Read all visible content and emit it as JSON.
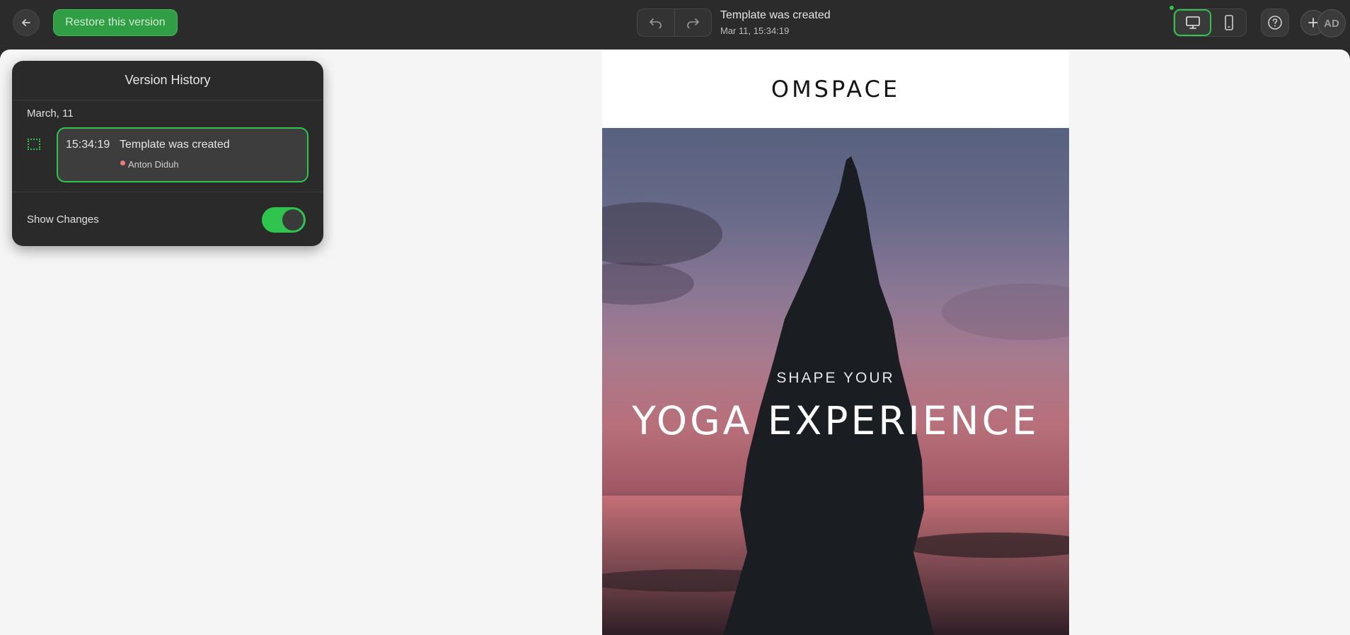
{
  "topbar": {
    "restore_label": "Restore this version",
    "status_title": "Template was created",
    "status_time": "Mar 11, 15:34:19",
    "avatar_initials": "AD"
  },
  "version_history": {
    "title": "Version History",
    "date": "March, 11",
    "entries": [
      {
        "time": "15:34:19",
        "message": "Template was created",
        "user": "Anton Diduh"
      }
    ],
    "show_changes_label": "Show Changes",
    "show_changes_on": true
  },
  "email": {
    "brand": "OMSPACE",
    "hero_kicker": "SHAPE YOUR",
    "hero_headline": "YOGA EXPERIENCE"
  },
  "colors": {
    "accent": "#2ec44e",
    "topbar_bg": "#2b2b2b",
    "canvas_bg": "#f5f5f5"
  },
  "icons": [
    "arrow-left-icon",
    "undo-icon",
    "redo-icon",
    "desktop-icon",
    "mobile-icon",
    "help-icon",
    "plus-icon",
    "selection-icon"
  ]
}
